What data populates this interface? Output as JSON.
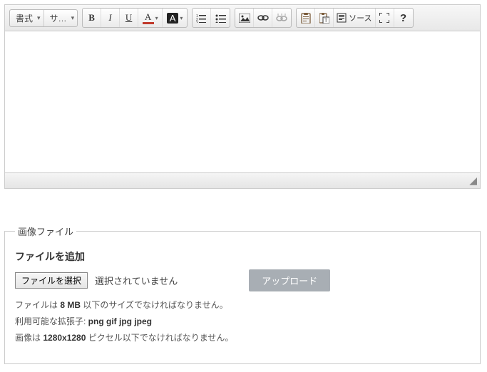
{
  "toolbar": {
    "format_label": "書式",
    "size_label": "サ…",
    "source_label": "ソース"
  },
  "fieldset": {
    "legend": "画像ファイル",
    "add_file": "ファイルを追加",
    "choose_button": "ファイルを選択",
    "no_file": "選択されていません",
    "upload_button": "アップロード",
    "hint_size_prefix": "ファイルは ",
    "hint_size_value": "8 MB",
    "hint_size_suffix": " 以下のサイズでなければなりません。",
    "hint_ext_prefix": "利用可能な拡張子: ",
    "hint_ext_value": "png gif jpg jpeg",
    "hint_dim_prefix": "画像は ",
    "hint_dim_value": "1280x1280",
    "hint_dim_suffix": " ピクセル以下でなければなりません。"
  }
}
